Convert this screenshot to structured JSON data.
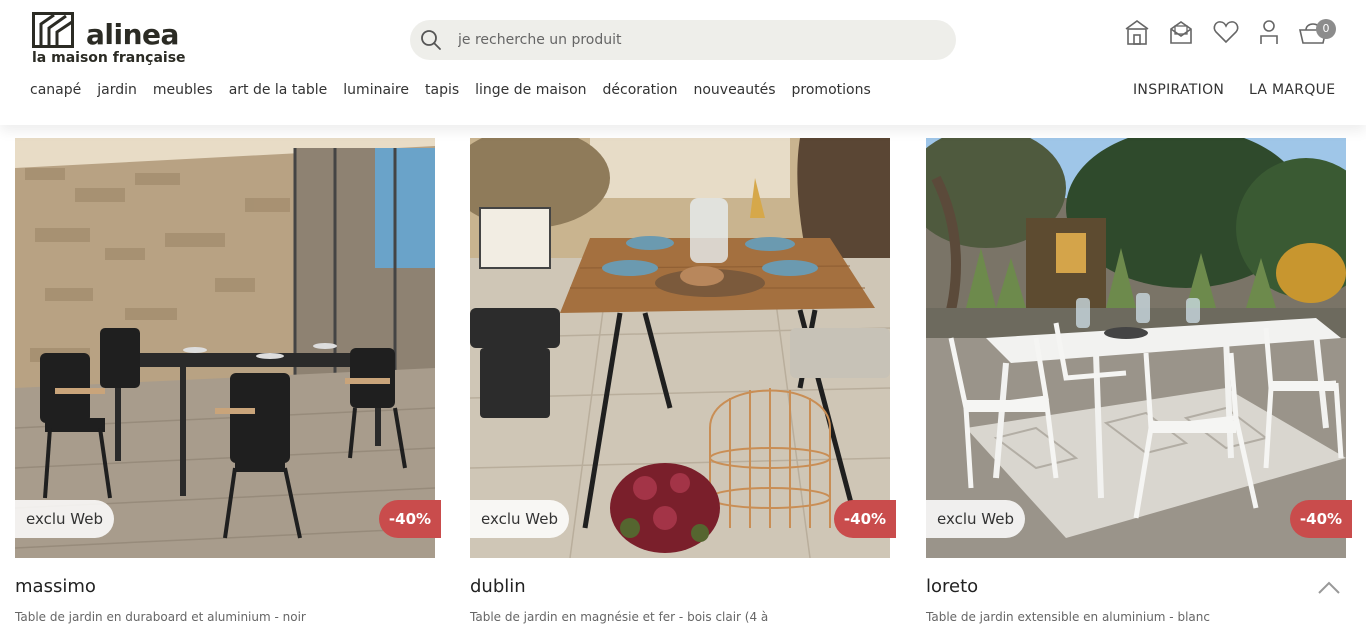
{
  "brand": {
    "name": "alinea",
    "tagline": "la maison française"
  },
  "search": {
    "placeholder": "je recherche un produit"
  },
  "header_icons": [
    "store-icon",
    "mail-icon",
    "heart-icon",
    "user-icon",
    "basket-icon"
  ],
  "cart": {
    "count": "0"
  },
  "nav": {
    "items": [
      "canapé",
      "jardin",
      "meubles",
      "art de la table",
      "luminaire",
      "tapis",
      "linge de maison",
      "décoration",
      "nouveautés",
      "promotions"
    ],
    "inspiration": "INSPIRATION",
    "brand_link": "LA MARQUE"
  },
  "products": [
    {
      "title": "massimo",
      "desc": "Table de jardin en duraboard et aluminium - noir",
      "badge": "exclu Web",
      "discount": "-40%"
    },
    {
      "title": "dublin",
      "desc": "Table de jardin en magnésie et fer - bois clair (4 à",
      "badge": "exclu Web",
      "discount": "-40%"
    },
    {
      "title": "loreto",
      "desc": "Table de jardin extensible en aluminium - blanc",
      "badge": "exclu Web",
      "discount": "-40%"
    }
  ],
  "colors": {
    "discount": "#c94c4c",
    "search_bg": "#eeeeea",
    "text_dark": "#2b2b24",
    "badge_grey": "#8c8c8c"
  }
}
